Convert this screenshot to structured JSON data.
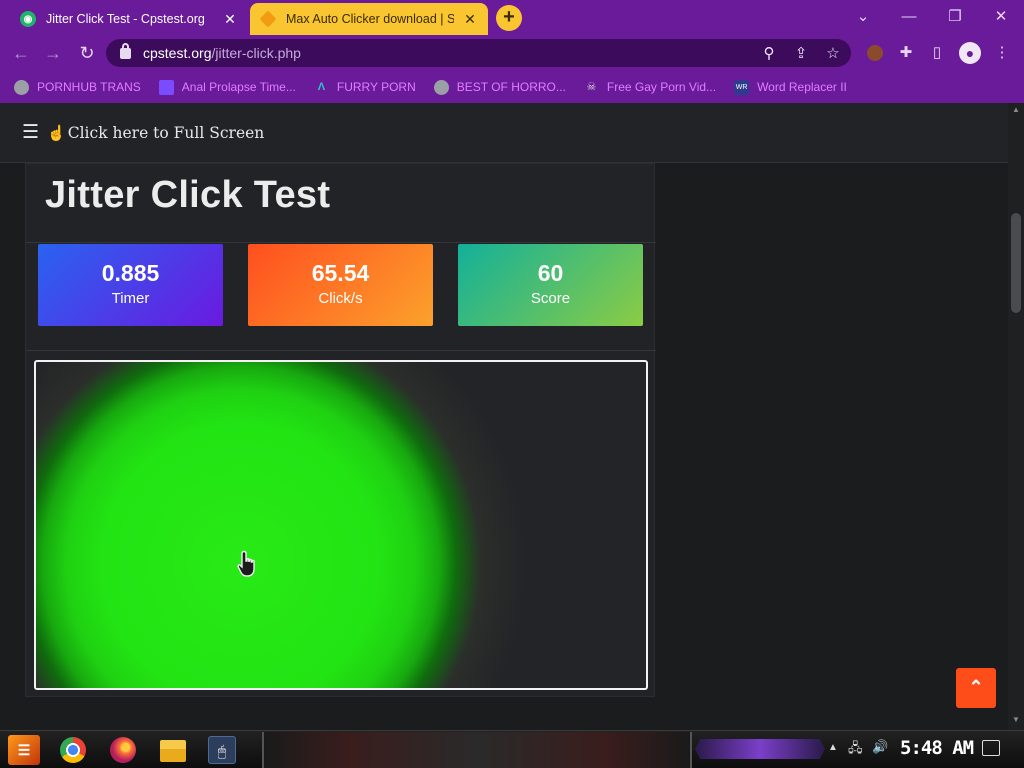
{
  "browser": {
    "tabs": [
      {
        "title": "Jitter Click Test - Cpstest.org",
        "active": true
      },
      {
        "title": "Max Auto Clicker download | S",
        "active": false
      }
    ],
    "new_tab": "+",
    "window_controls": {
      "chevron": "⌄",
      "minimize": "—",
      "restore": "❐",
      "close": "✕"
    },
    "nav": {
      "back": "←",
      "forward": "→",
      "reload": "↻"
    },
    "url_host": "cpstest.org",
    "url_path": "/jitter-click.php"
  },
  "bookmarks": [
    {
      "label": "PORNHUB TRANS",
      "icon": "globe-icon",
      "color": "#9aa0a6"
    },
    {
      "label": "Anal Prolapse Time...",
      "icon": "bookmark-icon",
      "color": "#7a4cff"
    },
    {
      "label": "FURRY PORN",
      "icon": "lambda-icon",
      "color": "#2ec4c4"
    },
    {
      "label": "BEST OF HORRO...",
      "icon": "globe-icon",
      "color": "#9aa0a6"
    },
    {
      "label": "Free Gay Porn Vid...",
      "icon": "skull-icon",
      "color": "#dddddd"
    },
    {
      "label": "Word Replacer II",
      "icon": "wr-icon",
      "color": "#2f3a8f"
    }
  ],
  "page": {
    "fullscreen_text": "Click here to Full Screen",
    "title": "Jitter Click Test",
    "stats": {
      "timer": {
        "value": "0.885",
        "label": "Timer"
      },
      "cps": {
        "value": "65.54",
        "label": "Click/s"
      },
      "score": {
        "value": "60",
        "label": "Score"
      }
    },
    "scroll_top": "⌃"
  },
  "taskbar": {
    "clock": "5:48 AM"
  },
  "colors": {
    "chrome_purple": "#6a1b9a",
    "timer_gradient": [
      "#2a63f0",
      "#6a1ae0"
    ],
    "cps_gradient": [
      "#ff4f1f",
      "#fca12c"
    ],
    "score_gradient": [
      "#13b09a",
      "#8bcc45"
    ],
    "click_ripple": "#22e313",
    "scroll_top_button": "#ff4d1a"
  }
}
